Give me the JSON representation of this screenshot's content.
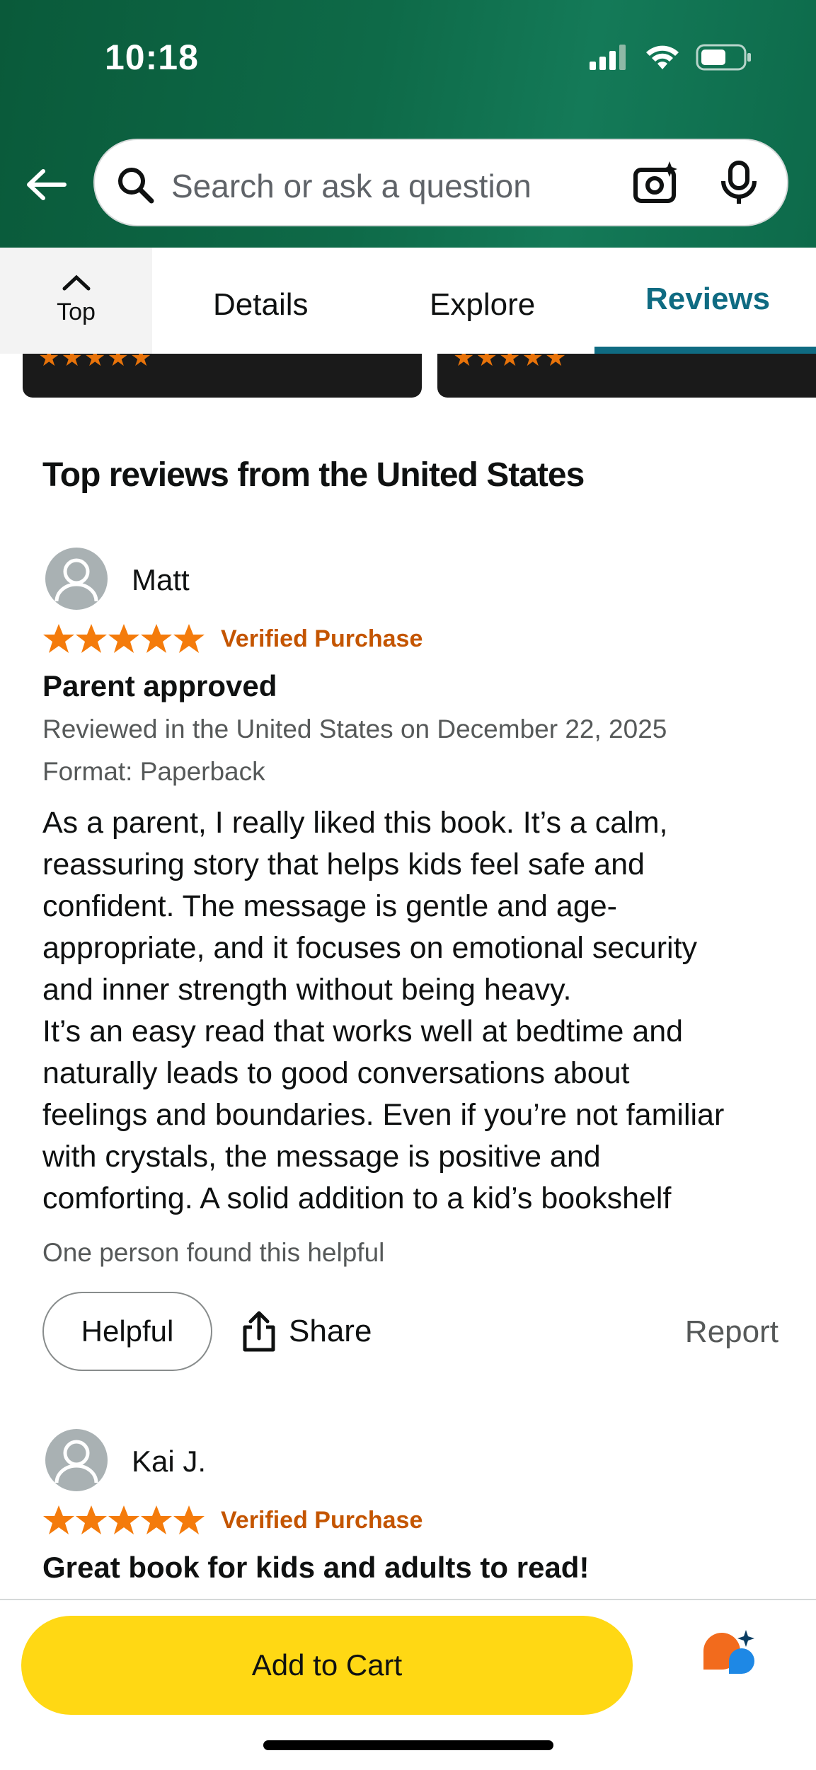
{
  "status_bar": {
    "time": "10:18"
  },
  "search": {
    "placeholder": "Search or ask a question"
  },
  "tabs": {
    "top_label": "Top",
    "items": [
      {
        "label": "Details",
        "active": false
      },
      {
        "label": "Explore",
        "active": false
      },
      {
        "label": "Reviews",
        "active": true
      }
    ]
  },
  "reviews_section": {
    "title": "Top reviews from the United States",
    "reviews": [
      {
        "user": "Matt",
        "rating": 5,
        "badge": "Verified Purchase",
        "title": "Parent approved",
        "reviewed": "Reviewed in the United States on December 22, 2025",
        "format": "Format: Paperback",
        "body_lines": [
          "As a parent, I really liked this book. It’s a calm,",
          "reassuring story that helps kids feel safe and",
          "confident. The message is gentle and age-",
          "appropriate, and it focuses on emotional security",
          "and inner strength without being heavy.",
          "It’s an easy read that works well at bedtime and",
          "naturally leads to good conversations about",
          "feelings and boundaries. Even if you’re not familiar",
          "with crystals, the message is positive and",
          "comforting. A solid addition to a kid’s bookshelf"
        ],
        "helpful_count": "One person found this helpful",
        "helpful_label": "Helpful",
        "share_label": "Share",
        "report_label": "Report"
      },
      {
        "user": "Kai J.",
        "rating": 5,
        "badge": "Verified Purchase",
        "title": "Great book for kids and adults to read!"
      }
    ]
  },
  "bottom_bar": {
    "add_to_cart": "Add to Cart"
  },
  "colors": {
    "header_green": "#0e6a48",
    "tab_active": "#0f6b82",
    "star": "#f47b0b",
    "verified": "#c45500",
    "cart_yellow": "#ffd814"
  },
  "icons": [
    "back-arrow-icon",
    "search-icon",
    "camera-sparkle-icon",
    "microphone-icon",
    "chevron-up-icon",
    "avatar-icon",
    "star-icon",
    "share-icon",
    "rufus-icon",
    "signal-icon",
    "wifi-icon",
    "battery-icon"
  ]
}
